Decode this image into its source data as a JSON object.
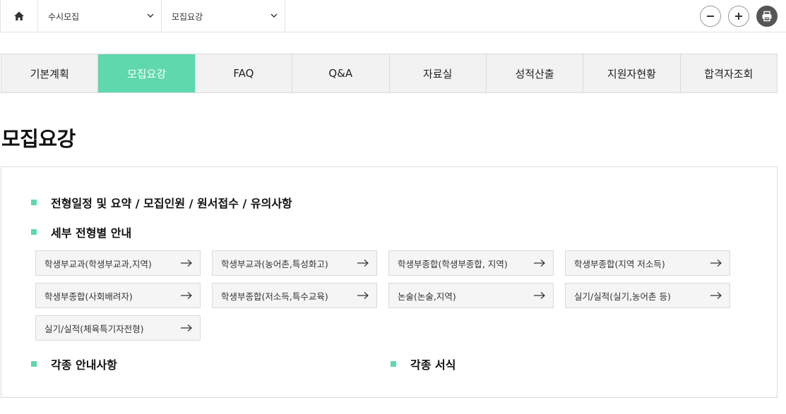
{
  "topbar": {
    "home_icon": "home-icon",
    "select1": "수시모집",
    "select2": "모집요강",
    "buttons": [
      "minus-icon",
      "plus-icon",
      "print-icon"
    ]
  },
  "tabs": [
    {
      "label": "기본계획"
    },
    {
      "label": "모집요강",
      "active": true
    },
    {
      "label": "FAQ"
    },
    {
      "label": "Q&A"
    },
    {
      "label": "자료실"
    },
    {
      "label": "성적산출"
    },
    {
      "label": "지원자현황"
    },
    {
      "label": "합격자조회"
    }
  ],
  "page_title": "모집요강",
  "sections": {
    "schedule": "전형일정 및 요약 / 모집인원 / 원서접수 / 유의사항",
    "detail": "세부 전형별 안내",
    "notices": "각종 안내사항",
    "forms": "각종 서식"
  },
  "links": [
    "학생부교과(학생부교과,지역)",
    "학생부교과(농어촌,특성화고)",
    "학생부종합(학생부종합, 지역)",
    "학생부종합(지역 저소득)",
    "학생부종합(사회배려자)",
    "학생부종합(저소득,특수교육)",
    "논술(논술,지역)",
    "실기/실적(실기,농어촌 등)",
    "실기/실적(체육특기자전형)"
  ],
  "colors": {
    "accent": "#5fd8ad",
    "tab_bg": "#f2f2f2",
    "border": "#dadada"
  }
}
